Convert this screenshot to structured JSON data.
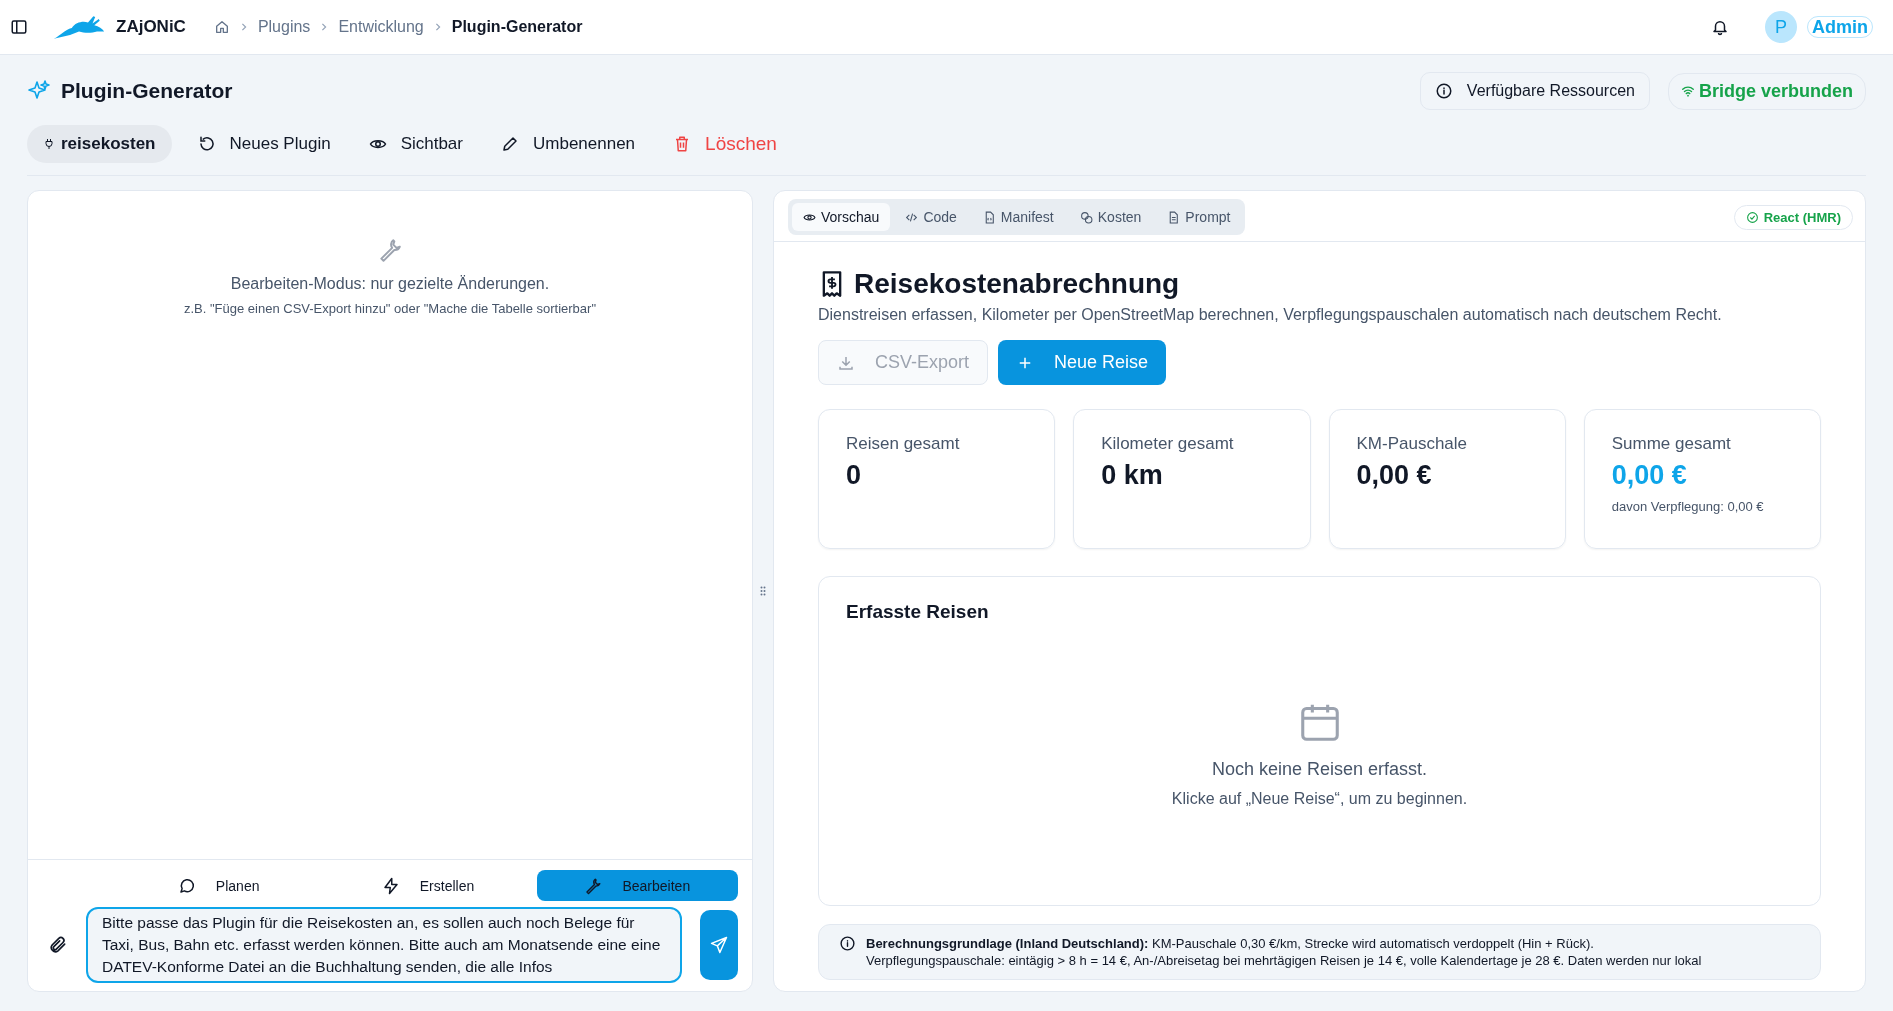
{
  "topbar": {
    "app_name": "ZAjONiC",
    "breadcrumbs": [
      {
        "label": "Plugins"
      },
      {
        "label": "Entwicklung"
      },
      {
        "label": "Plugin-Generator"
      }
    ],
    "user": {
      "initial": "P",
      "name": "Admin"
    }
  },
  "header": {
    "title": "Plugin-Generator",
    "resources_button": "Verfügbare Ressourcen",
    "bridge_status": "Bridge verbunden"
  },
  "toolbar": [
    {
      "label": "reisekosten",
      "kind": "plugin"
    },
    {
      "label": "Neues Plugin",
      "kind": "new"
    },
    {
      "label": "Sichtbar",
      "kind": "visible"
    },
    {
      "label": "Umbenennen",
      "kind": "rename"
    },
    {
      "label": "Löschen",
      "kind": "delete"
    }
  ],
  "chat": {
    "hint_title": "Bearbeiten-Modus: nur gezielte Änderungen.",
    "hint_example": "z.B. \"Füge einen CSV-Export hinzu\" oder \"Mache die Tabelle sortierbar\"",
    "modes": [
      {
        "label": "Planen",
        "kind": "plan",
        "selected": false
      },
      {
        "label": "Erstellen",
        "kind": "create",
        "selected": false
      },
      {
        "label": "Bearbeiten",
        "kind": "edit",
        "selected": true
      }
    ],
    "input": "Bitte passe das Plugin für die Reisekosten an, es sollen auch noch Belege für Taxi, Bus, Bahn etc. erfasst werden können. Bitte auch am Monatsende eine eine DATEV-Konforme Datei an die Buchhaltung senden, die alle Infos"
  },
  "preview": {
    "tabs": [
      {
        "label": "Vorschau",
        "kind": "eye",
        "selected": true
      },
      {
        "label": "Code",
        "kind": "code",
        "selected": false
      },
      {
        "label": "Manifest",
        "kind": "file",
        "selected": false
      },
      {
        "label": "Kosten",
        "kind": "coins",
        "selected": false
      },
      {
        "label": "Prompt",
        "kind": "doc",
        "selected": false
      }
    ],
    "runtime_badge": "React (HMR)",
    "title": "Reisekostenabrechnung",
    "description": "Dienstreisen erfassen, Kilometer per OpenStreetMap berechnen, Verpflegungspauschalen automatisch nach deutschem Recht.",
    "buttons": [
      {
        "label": "CSV-Export",
        "kind": "export",
        "disabled": true
      },
      {
        "label": "Neue Reise",
        "kind": "add",
        "disabled": false
      }
    ],
    "stats": [
      {
        "label": "Reisen gesamt",
        "value": "0",
        "highlight": false
      },
      {
        "label": "Kilometer gesamt",
        "value": "0 km",
        "highlight": false
      },
      {
        "label": "KM-Pauschale",
        "value": "0,00 €",
        "highlight": false
      },
      {
        "label": "Summe gesamt",
        "value": "0,00 €",
        "highlight": true,
        "note": "davon Verpflegung: 0,00 €"
      }
    ],
    "trips": {
      "title": "Erfasste Reisen",
      "empty_title": "Noch keine Reisen erfasst.",
      "empty_hint": "Klicke auf „Neue Reise“, um zu beginnen."
    },
    "info": "**Berechnungsgrundlage (Inland Deutschland):** KM-Pauschale 0,30 €/km, Strecke wird automatisch verdoppelt (Hin + Rück).\nVerpflegungspauschale: eintägig > 8 h = 14 €, An-/Abreisetag bei mehrtägigen Reisen je 14 €, volle Kalendertage je 28 €. Daten werden nur lokal"
  }
}
